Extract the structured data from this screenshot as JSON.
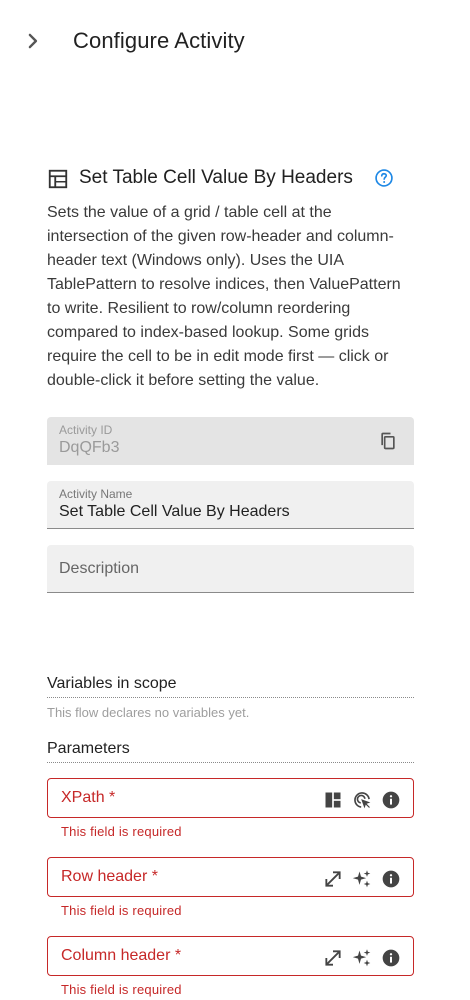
{
  "header": {
    "title": "Configure Activity",
    "back_icon": "chevron-right-icon"
  },
  "activity": {
    "icon": "table-icon",
    "title": "Set Table Cell Value By Headers",
    "help_icon": "help-circle-icon",
    "description": "Sets the value of a grid / table cell at the intersection of the given row-header and column-header text (Windows only). Uses the UIA TablePattern to resolve indices, then ValuePattern to write. Resilient to row/column reordering compared to index-based lookup. Some grids require the cell to be in edit mode first — click or double-click it before setting the value."
  },
  "fields": {
    "activity_id": {
      "label": "Activity ID",
      "value": "DqQFb3",
      "icon": "copy-icon"
    },
    "activity_name": {
      "label": "Activity Name",
      "value": "Set Table Cell Value By Headers"
    },
    "description": {
      "placeholder": "Description"
    }
  },
  "variables": {
    "title": "Variables in scope",
    "empty_note": "This flow declares no variables yet."
  },
  "parameters": {
    "title": "Parameters",
    "items": [
      {
        "label": "XPath *",
        "error": "This field is required",
        "icons": [
          "dashboard-layout-icon",
          "target-select-icon",
          "info-icon"
        ]
      },
      {
        "label": "Row header *",
        "error": "This field is required",
        "icons": [
          "expand-icon",
          "sparkles-icon",
          "info-icon"
        ]
      },
      {
        "label": "Column header *",
        "error": "This field is required",
        "icons": [
          "expand-icon",
          "sparkles-icon",
          "info-icon"
        ]
      }
    ]
  },
  "colors": {
    "error": "#c62828",
    "accent": "#1e88e5",
    "field_bg": "#f0f0f0",
    "field_disabled_bg": "#e4e4e4"
  }
}
